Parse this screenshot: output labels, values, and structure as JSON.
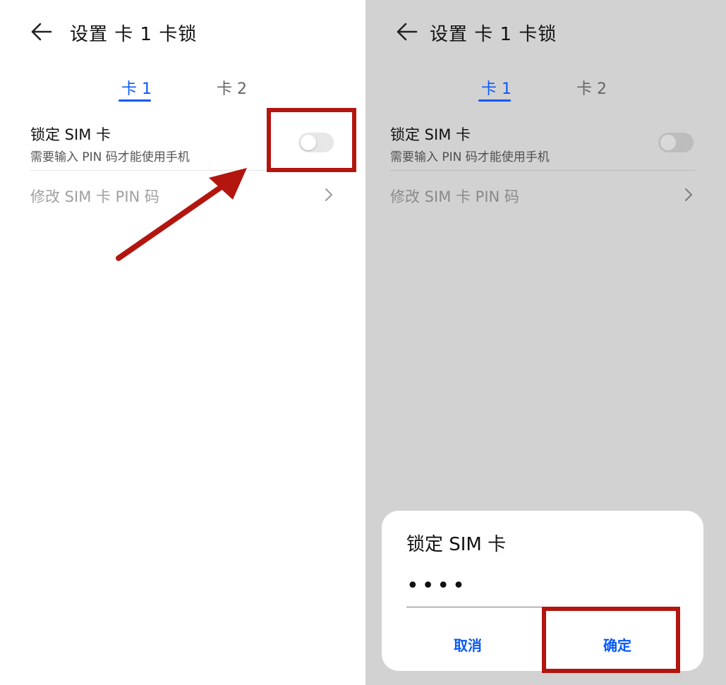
{
  "screens": [
    {
      "title": "设置 卡 1 卡锁",
      "tabs": [
        "卡 1",
        "卡 2"
      ],
      "lock_row": {
        "title": "锁定 SIM 卡",
        "subtitle": "需要输入 PIN 码才能使用手机"
      },
      "pin_row": {
        "label": "修改 SIM 卡 PIN 码"
      }
    },
    {
      "title": "设置 卡 1 卡锁",
      "tabs": [
        "卡 1",
        "卡 2"
      ],
      "lock_row": {
        "title": "锁定 SIM 卡",
        "subtitle": "需要输入 PIN 码才能使用手机"
      },
      "pin_row": {
        "label": "修改 SIM 卡 PIN 码"
      }
    }
  ],
  "dialog": {
    "title": "锁定 SIM 卡",
    "pin_value": "••••",
    "cancel_label": "取消",
    "confirm_label": "确定"
  },
  "colors": {
    "accent": "#0a59f7",
    "highlight": "#b3150f",
    "overlay": "#d2d2d2"
  },
  "icons": [
    "arrow-left-icon",
    "chevron-right-icon"
  ]
}
